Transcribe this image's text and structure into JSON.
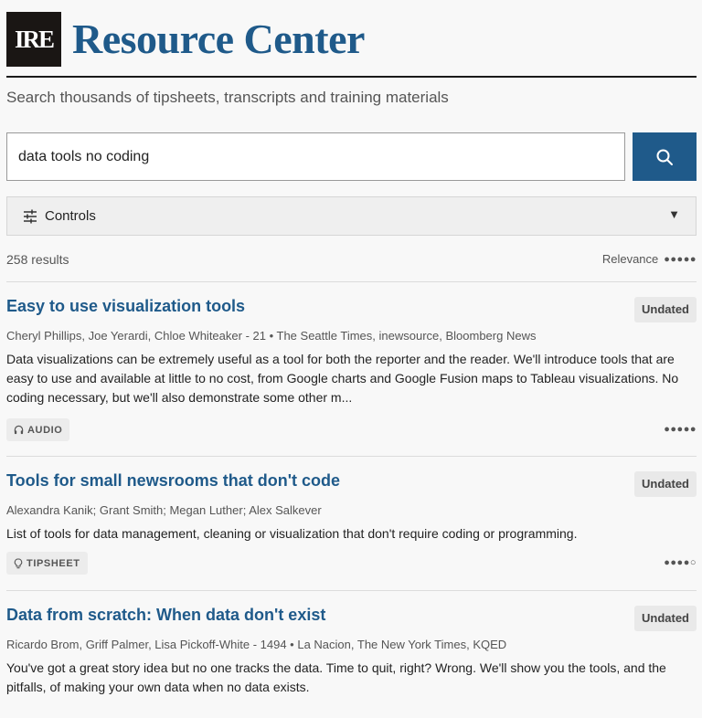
{
  "header": {
    "logo_text": "IRE",
    "title": "Resource Center",
    "tagline": "Search thousands of tipsheets, transcripts and training materials"
  },
  "search": {
    "value": "data tools no coding",
    "button_icon": "search-icon"
  },
  "controls": {
    "label": "Controls",
    "icon": "sliders-icon",
    "caret": "▼"
  },
  "results_header": {
    "count": "258 results",
    "sort_label": "Relevance",
    "sort_indicator": "●●●●●"
  },
  "results": [
    {
      "title": "Easy to use visualization tools",
      "badge": "Undated",
      "meta": "Cheryl Phillips, Joe Yerardi, Chloe Whiteaker - 21 • The Seattle Times, inewsource, Bloomberg News",
      "description": "Data visualizations can be extremely useful as a tool for both the reporter and the reader. We'll introduce tools that are easy to use and available at little to no cost, from Google charts and Google Fusion maps to Tableau visualizations. No coding necessary, but we'll also demonstrate some other m...",
      "type": "AUDIO",
      "type_icon": "headphones-icon",
      "relevance": "●●●●●"
    },
    {
      "title": "Tools for small newsrooms that don't code",
      "badge": "Undated",
      "meta": "Alexandra Kanik; Grant Smith; Megan Luther; Alex Salkever",
      "description": "List of tools for data management, cleaning or visualization that don't require coding or programming.",
      "type": "TIPSHEET",
      "type_icon": "lightbulb-icon",
      "relevance": "●●●●○"
    },
    {
      "title": "Data from scratch: When data don't exist",
      "badge": "Undated",
      "meta": "Ricardo Brom, Griff Palmer, Lisa Pickoff-White - 1494 • La Nacion, The New York Times, KQED",
      "description": "You've got a great story idea but no one tracks the data. Time to quit, right? Wrong. We'll show you the tools, and the pitfalls, of making your own data when no data exists."
    }
  ]
}
